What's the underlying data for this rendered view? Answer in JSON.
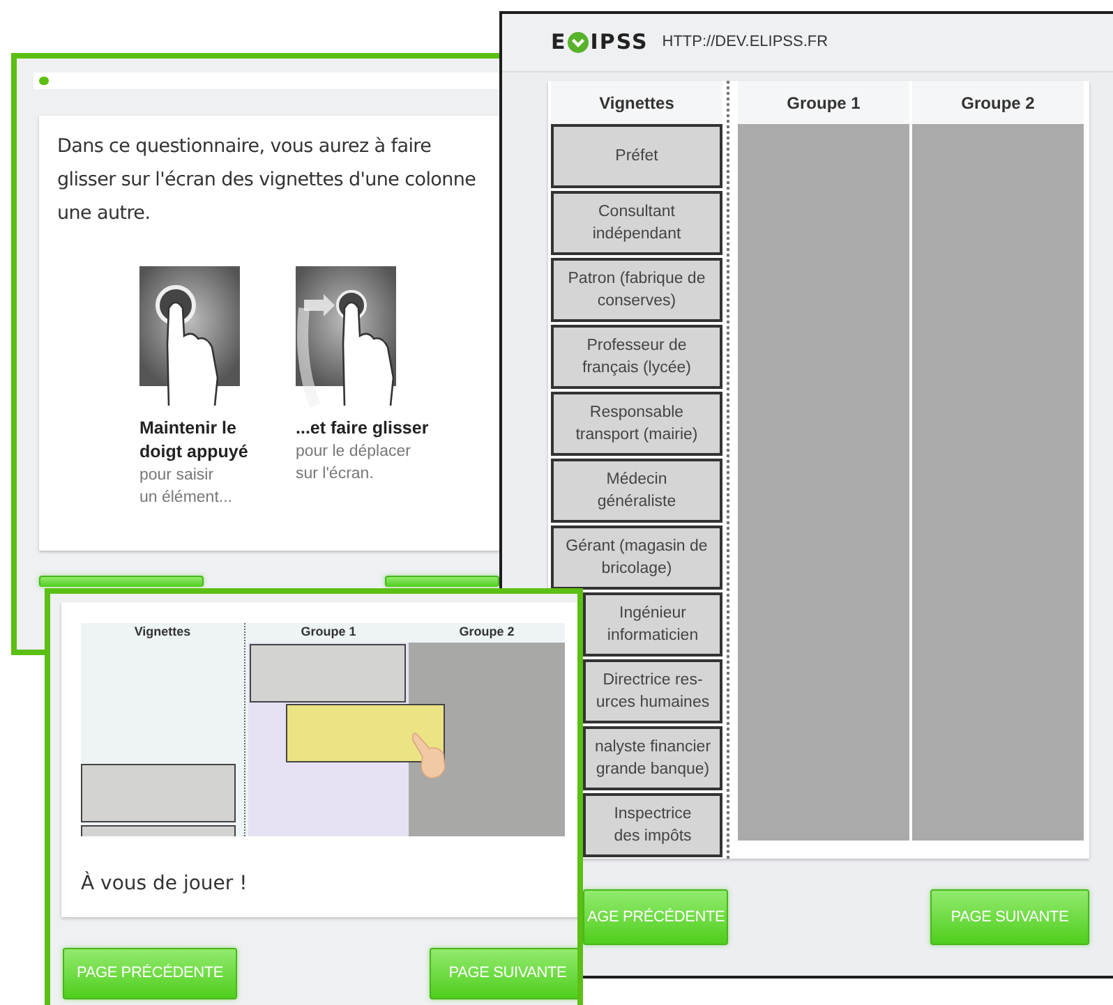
{
  "intro_window": {
    "progress": {
      "level": 0.02
    },
    "instruction": "Dans ce questionnaire, vous aurez à faire\nglisser sur l'écran des vignettes d'une colonne\nune autre.",
    "steps": [
      {
        "kind": "press",
        "title": "Maintenir le doigt appuyé",
        "detail": "pour saisir\nun élément..."
      },
      {
        "kind": "drag",
        "title": "...et faire glisser",
        "detail": "pour le déplacer\nsur l'écran."
      }
    ],
    "buttons": [
      {
        "kind": "previous"
      },
      {
        "kind": "next"
      }
    ]
  },
  "sort_window": {
    "logo": {
      "before": "E",
      "after": "IPSS"
    },
    "url": "HTTP://DEV.ELIPSS.FR",
    "columns": [
      "Vignettes",
      "Groupe 1",
      "Groupe 2"
    ],
    "cards": [
      {
        "text": "Préfet",
        "covered": false
      },
      {
        "text": "Consultant\nindépendant",
        "covered": false
      },
      {
        "text": "Patron (fabrique de\nconserves)",
        "covered": false
      },
      {
        "text": "Professeur de\nfrançais (lycée)",
        "covered": false
      },
      {
        "text": "Responsable\ntransport (mairie)",
        "covered": false
      },
      {
        "text": "Médecin\ngénéraliste",
        "covered": false
      },
      {
        "text": "Gérant (magasin de\nbricolage)",
        "covered": false
      },
      {
        "text": "Ingénieur\ninformaticien",
        "covered": true
      },
      {
        "text": "Directrice res-\nurces humaines",
        "covered": true
      },
      {
        "text": "nalyste financier\ngrande banque)",
        "covered": true
      },
      {
        "text": "Inspectrice\ndes impôts",
        "covered": true
      }
    ],
    "buttons": [
      {
        "kind": "previous",
        "label": "AGE PRÉCÉDENTE"
      },
      {
        "kind": "next",
        "label": "PAGE SUIVANTE"
      }
    ]
  },
  "demo_window": {
    "demo": {
      "columns": [
        "Vignettes",
        "Groupe 1",
        "Groupe 2"
      ]
    },
    "prompt": "À vous de jouer !",
    "buttons": [
      {
        "kind": "previous",
        "label": "PAGE PRÉCÉDENTE"
      },
      {
        "kind": "next",
        "label": "PAGE SUIVANTE"
      }
    ]
  }
}
